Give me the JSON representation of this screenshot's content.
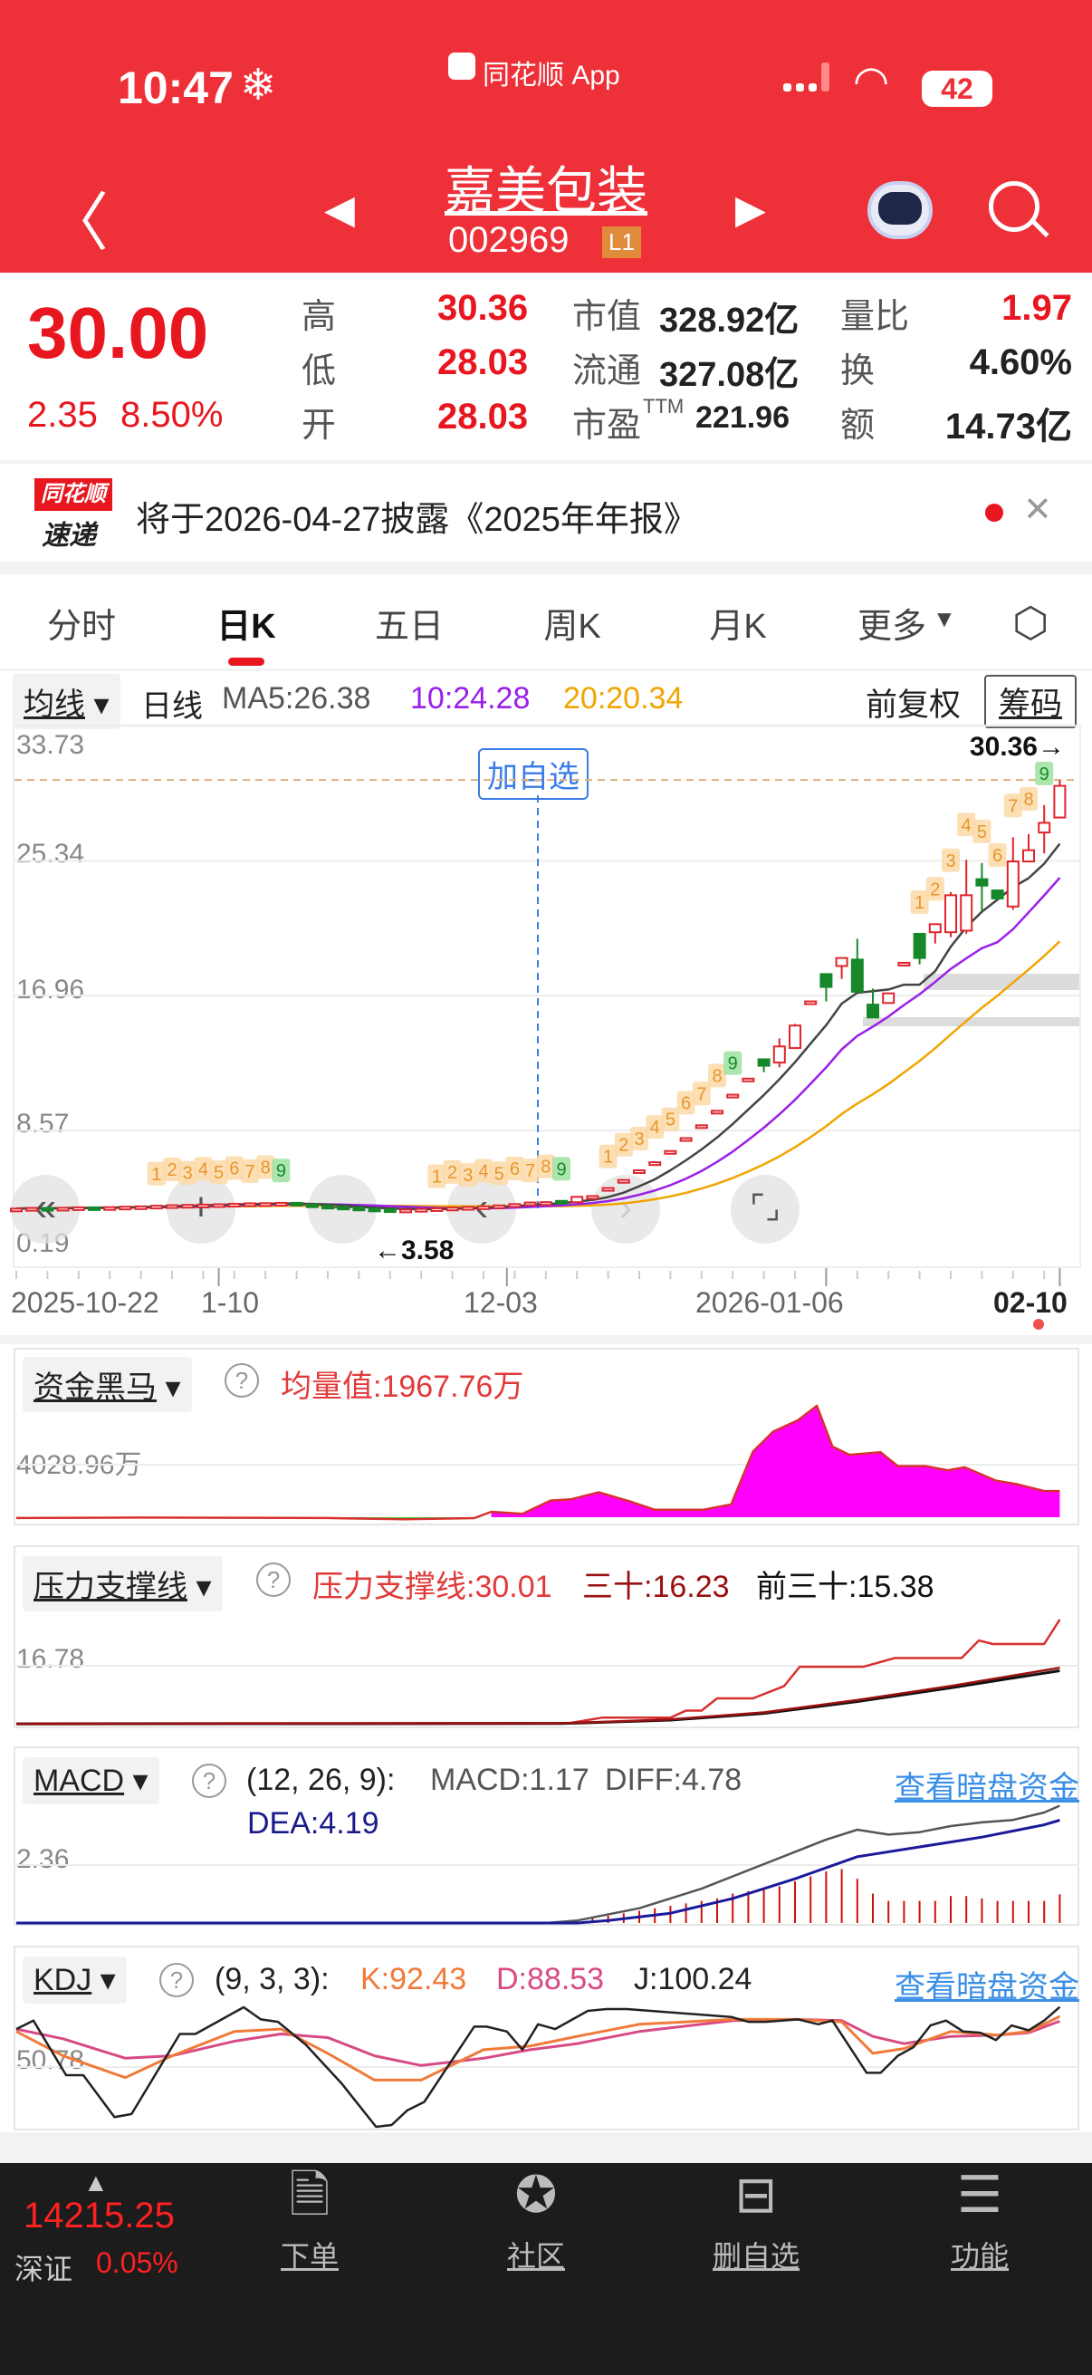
{
  "status_bar": {
    "time": "10:47",
    "app": "同花顺 App",
    "battery": "42"
  },
  "header": {
    "stock_name": "嘉美包装",
    "stock_code": "002969",
    "level_badge": "L1"
  },
  "quote": {
    "price": "30.00",
    "change": "2.35",
    "change_pct": "8.50%",
    "rows": [
      {
        "l1": "高",
        "v1": "30.36",
        "l2": "市值",
        "v2": "328.92亿",
        "l3": "量比",
        "v3": "1.97"
      },
      {
        "l1": "低",
        "v1": "28.03",
        "l2": "流通",
        "v2": "327.08亿",
        "l3": "换",
        "v3": "4.60%"
      },
      {
        "l1": "开",
        "v1": "28.03",
        "l2": "市盈",
        "l2sup": "TTM",
        "v2": "221.96",
        "l3": "额",
        "v3": "14.73亿"
      }
    ]
  },
  "notice": {
    "logo_top": "同花顺",
    "logo_bottom": "速递",
    "text": "将于2026-04-27披露《2025年年报》"
  },
  "tabs": [
    "分时",
    "日K",
    "五日",
    "周K",
    "月K",
    "更多"
  ],
  "active_tab": "日K",
  "ma_bar": {
    "selector": "均线",
    "period": "日线",
    "ma5": "MA5:26.38",
    "ma10": "10:24.28",
    "ma20": "20:20.34",
    "adjust": "前复权",
    "chips": "筹码"
  },
  "kchart": {
    "add_watch": "加自选",
    "high_marker": "30.36→",
    "low_marker": "←3.58",
    "y_labels": [
      "33.73",
      "25.34",
      "16.96",
      "8.57",
      "0.19"
    ],
    "dates": [
      "2025-10-22",
      "1-10",
      "12-03",
      "2026-01-06",
      "02-10"
    ]
  },
  "colors": {
    "up": "#e0242a",
    "down": "#16882a",
    "ma5": "#444444",
    "ma10": "#9b1fe8",
    "ma20": "#f0a500"
  },
  "panels": {
    "zjhm": {
      "selector": "资金黑马",
      "value": "均量值:1967.76万",
      "axis": "4028.96万"
    },
    "ylzc": {
      "selector": "压力支撑线",
      "v1": "压力支撑线:30.01",
      "v2": "三十:16.23",
      "v3": "前三十:15.38",
      "axis": "16.78"
    },
    "macd": {
      "selector": "MACD",
      "params": "(12, 26, 9):",
      "macd": "MACD:1.17",
      "diff": "DIFF:4.78",
      "dea": "DEA:4.19",
      "axis": "2.36",
      "link": "查看暗盘资金"
    },
    "kdj": {
      "selector": "KDJ",
      "params": "(9, 3, 3):",
      "k": "K:92.43",
      "d": "D:88.53",
      "j": "J:100.24",
      "axis": "50.78",
      "link": "查看暗盘资金"
    }
  },
  "bottom": {
    "index_value": "14215.25",
    "index_name": "深证",
    "index_pct": "0.05%",
    "items": [
      "下单",
      "社区",
      "删自选",
      "功能"
    ]
  },
  "chart_data": {
    "type": "candlestick",
    "ylim": [
      0.19,
      33.73
    ],
    "ohlc": [
      [
        3.7,
        3.74,
        3.66,
        3.72
      ],
      [
        3.72,
        3.78,
        3.7,
        3.76
      ],
      [
        3.76,
        3.8,
        3.72,
        3.74
      ],
      [
        3.74,
        3.79,
        3.71,
        3.77
      ],
      [
        3.77,
        3.82,
        3.74,
        3.8
      ],
      [
        3.8,
        3.84,
        3.76,
        3.78
      ],
      [
        3.78,
        3.83,
        3.75,
        3.81
      ],
      [
        3.81,
        3.86,
        3.78,
        3.84
      ],
      [
        3.84,
        3.88,
        3.8,
        3.86
      ],
      [
        3.86,
        3.92,
        3.83,
        3.9
      ],
      [
        3.9,
        3.96,
        3.86,
        3.93
      ],
      [
        3.93,
        3.98,
        3.88,
        3.95
      ],
      [
        3.95,
        4.0,
        3.9,
        3.97
      ],
      [
        3.97,
        4.02,
        3.92,
        3.99
      ],
      [
        3.99,
        4.05,
        3.94,
        4.02
      ],
      [
        4.02,
        4.08,
        3.96,
        4.05
      ],
      [
        4.05,
        4.1,
        3.98,
        4.06
      ],
      [
        4.06,
        4.12,
        4.0,
        4.08
      ],
      [
        4.08,
        4.1,
        3.95,
        3.98
      ],
      [
        3.98,
        4.0,
        3.88,
        3.9
      ],
      [
        3.9,
        3.93,
        3.8,
        3.84
      ],
      [
        3.84,
        3.86,
        3.74,
        3.78
      ],
      [
        3.78,
        3.8,
        3.68,
        3.72
      ],
      [
        3.72,
        3.75,
        3.64,
        3.68
      ],
      [
        3.68,
        3.72,
        3.6,
        3.64
      ],
      [
        3.64,
        3.68,
        3.58,
        3.66
      ],
      [
        3.66,
        3.72,
        3.62,
        3.7
      ],
      [
        3.7,
        3.76,
        3.66,
        3.74
      ],
      [
        3.74,
        3.8,
        3.7,
        3.78
      ],
      [
        3.78,
        3.84,
        3.74,
        3.82
      ],
      [
        3.82,
        3.88,
        3.78,
        3.86
      ],
      [
        3.86,
        3.94,
        3.82,
        3.92
      ],
      [
        3.92,
        4.02,
        3.88,
        4.0
      ],
      [
        4.0,
        4.12,
        3.96,
        4.1
      ],
      [
        4.0,
        4.15,
        3.98,
        4.12
      ],
      [
        4.2,
        4.22,
        4.08,
        4.12
      ],
      [
        4.12,
        4.5,
        4.1,
        4.45
      ],
      [
        4.45,
        4.55,
        4.4,
        4.5
      ],
      [
        4.9,
        5.0,
        4.9,
        5.0
      ],
      [
        5.4,
        5.5,
        5.4,
        5.5
      ],
      [
        6.0,
        6.1,
        6.0,
        6.1
      ],
      [
        6.5,
        6.6,
        6.5,
        6.6
      ],
      [
        7.2,
        7.3,
        7.2,
        7.3
      ],
      [
        8.0,
        8.1,
        8.0,
        8.1
      ],
      [
        8.8,
        8.9,
        8.8,
        8.9
      ],
      [
        9.7,
        9.8,
        9.7,
        9.8
      ],
      [
        10.7,
        10.8,
        10.7,
        10.8
      ],
      [
        11.7,
        11.8,
        11.7,
        11.8
      ],
      [
        13.0,
        13.0,
        12.2,
        12.6
      ],
      [
        12.8,
        14.3,
        12.5,
        13.8
      ],
      [
        13.7,
        15.2,
        13.7,
        15.1
      ],
      [
        16.5,
        16.6,
        16.5,
        16.6
      ],
      [
        18.3,
        18.3,
        16.6,
        17.5
      ],
      [
        18.8,
        19.3,
        18.0,
        19.3
      ],
      [
        19.2,
        20.5,
        17.2,
        17.2
      ],
      [
        16.4,
        17.4,
        15.6,
        15.6
      ],
      [
        16.5,
        17.1,
        16.5,
        17.1
      ],
      [
        18.9,
        19.0,
        18.9,
        19.0
      ],
      [
        20.8,
        20.8,
        18.9,
        19.3
      ],
      [
        20.9,
        21.4,
        20.2,
        21.4
      ],
      [
        20.9,
        23.4,
        20.6,
        23.2
      ],
      [
        21.0,
        25.4,
        20.8,
        23.2
      ],
      [
        24.2,
        25.2,
        22.2,
        23.8
      ],
      [
        23.5,
        23.5,
        22.9,
        23.0
      ],
      [
        22.5,
        26.8,
        22.3,
        25.3
      ],
      [
        25.3,
        27.0,
        25.3,
        26.0
      ],
      [
        27.1,
        28.8,
        25.8,
        27.7
      ],
      [
        28.03,
        30.36,
        28.03,
        30.0
      ]
    ],
    "td_sequences": [
      9,
      27,
      38,
      58
    ],
    "zjhm": [
      [
        0,
        -60
      ],
      [
        7.9,
        -30
      ],
      [
        14.6,
        -40
      ],
      [
        20,
        -60
      ],
      [
        24.9,
        -150
      ],
      [
        29.4,
        -70
      ],
      [
        30.5,
        415
      ],
      [
        32.5,
        255
      ],
      [
        34.3,
        1280
      ],
      [
        35.6,
        1370
      ],
      [
        37.4,
        1910
      ],
      [
        39.4,
        1210
      ],
      [
        41,
        570
      ],
      [
        44.1,
        570
      ],
      [
        45.9,
        990
      ],
      [
        47.3,
        5040
      ],
      [
        48.6,
        6570
      ],
      [
        50.2,
        7440
      ],
      [
        51.4,
        8550
      ],
      [
        52.4,
        5420
      ],
      [
        53.5,
        4790
      ],
      [
        55.5,
        4980
      ],
      [
        56.6,
        3920
      ],
      [
        58.4,
        3920
      ],
      [
        59.8,
        3600
      ],
      [
        60.9,
        3830
      ],
      [
        62.9,
        2810
      ],
      [
        64.2,
        2550
      ],
      [
        66,
        2010
      ],
      [
        67,
        2010
      ]
    ],
    "ylzc": {
      "pressure": [
        [
          0,
          0.3
        ],
        [
          35.6,
          0.5
        ],
        [
          37.6,
          2
        ],
        [
          42,
          2
        ],
        [
          43,
          4
        ],
        [
          44,
          4
        ],
        [
          45,
          7.5
        ],
        [
          47.3,
          7.5
        ],
        [
          49.3,
          11
        ],
        [
          50.3,
          16.5
        ],
        [
          54.4,
          16.5
        ],
        [
          56.4,
          19
        ],
        [
          60.7,
          19
        ],
        [
          61.8,
          24
        ],
        [
          62.7,
          23
        ],
        [
          66,
          23
        ],
        [
          67,
          30.01
        ]
      ],
      "thirty": [
        [
          0,
          0.2
        ],
        [
          35,
          0.4
        ],
        [
          42,
          1.5
        ],
        [
          48,
          3.5
        ],
        [
          54,
          7
        ],
        [
          60,
          11
        ],
        [
          64,
          14
        ],
        [
          67,
          16.23
        ]
      ],
      "prev_thirty": [
        [
          0,
          0.2
        ],
        [
          35,
          0.3
        ],
        [
          42,
          1.3
        ],
        [
          48,
          3.2
        ],
        [
          54,
          6.6
        ],
        [
          60,
          10.5
        ],
        [
          64,
          13.3
        ],
        [
          67,
          15.38
        ]
      ]
    },
    "macd": {
      "diff": [
        [
          0,
          0
        ],
        [
          34,
          0
        ],
        [
          36,
          0.1
        ],
        [
          40,
          0.6
        ],
        [
          44,
          1.4
        ],
        [
          48,
          2.4
        ],
        [
          52,
          3.4
        ],
        [
          54,
          3.8
        ],
        [
          56,
          3.6
        ],
        [
          58,
          3.7
        ],
        [
          60,
          3.95
        ],
        [
          62,
          4.1
        ],
        [
          64,
          4.2
        ],
        [
          66,
          4.5
        ],
        [
          67,
          4.78
        ]
      ],
      "dea": [
        [
          0,
          0
        ],
        [
          36,
          0
        ],
        [
          38,
          0.1
        ],
        [
          42,
          0.4
        ],
        [
          46,
          1.0
        ],
        [
          50,
          1.8
        ],
        [
          54,
          2.7
        ],
        [
          58,
          3.1
        ],
        [
          62,
          3.5
        ],
        [
          66,
          4.0
        ],
        [
          67,
          4.19
        ]
      ],
      "bars_from": 36,
      "bars": [
        0.1,
        0.2,
        0.3,
        0.4,
        0.5,
        0.6,
        0.7,
        0.8,
        0.9,
        1.0,
        1.2,
        1.3,
        1.4,
        1.5,
        1.7,
        1.9,
        2.1,
        2.2,
        1.8,
        1.2,
        0.9,
        0.9,
        0.9,
        0.9,
        1.1,
        1.1,
        1.0,
        0.9,
        0.9,
        0.9,
        0.9,
        1.17
      ]
    },
    "kdj": {
      "k": [
        [
          0,
          80
        ],
        [
          3,
          60
        ],
        [
          7,
          42
        ],
        [
          10,
          60
        ],
        [
          14,
          80
        ],
        [
          17,
          82
        ],
        [
          20,
          62
        ],
        [
          23,
          40
        ],
        [
          26,
          40
        ],
        [
          30,
          65
        ],
        [
          33,
          68
        ],
        [
          36,
          76
        ],
        [
          40,
          86
        ],
        [
          46,
          90
        ],
        [
          50,
          90
        ],
        [
          53,
          88
        ],
        [
          55,
          62
        ],
        [
          57,
          66
        ],
        [
          60,
          80
        ],
        [
          63,
          77
        ],
        [
          65,
          80
        ],
        [
          67,
          92.43
        ]
      ],
      "d": [
        [
          0,
          82
        ],
        [
          3,
          74
        ],
        [
          7,
          58
        ],
        [
          10,
          60
        ],
        [
          14,
          72
        ],
        [
          17,
          78
        ],
        [
          20,
          75
        ],
        [
          23,
          60
        ],
        [
          26,
          52
        ],
        [
          30,
          58
        ],
        [
          33,
          65
        ],
        [
          36,
          70
        ],
        [
          40,
          80
        ],
        [
          46,
          89
        ],
        [
          50,
          90
        ],
        [
          53,
          89
        ],
        [
          55,
          76
        ],
        [
          57,
          70
        ],
        [
          60,
          76
        ],
        [
          63,
          77
        ],
        [
          65,
          79
        ],
        [
          67,
          88.53
        ]
      ],
      "j": [
        [
          0,
          82
        ],
        [
          1.1,
          89
        ],
        [
          3.2,
          44
        ],
        [
          4.3,
          44
        ],
        [
          6.3,
          9.5
        ],
        [
          7.4,
          12
        ],
        [
          10.5,
          78
        ],
        [
          11.5,
          78
        ],
        [
          14.6,
          100
        ],
        [
          15.7,
          90
        ],
        [
          16.8,
          88
        ],
        [
          18.6,
          69
        ],
        [
          20.9,
          37
        ],
        [
          23.1,
          1
        ],
        [
          24.1,
          3
        ],
        [
          25.1,
          15
        ],
        [
          26.2,
          22
        ],
        [
          29.4,
          84
        ],
        [
          30.2,
          84
        ],
        [
          31.5,
          80
        ],
        [
          32.5,
          65
        ],
        [
          33.5,
          86
        ],
        [
          34.6,
          82
        ],
        [
          36.7,
          97
        ],
        [
          37.9,
          98.5
        ],
        [
          39.2,
          98.5
        ],
        [
          45.9,
          92
        ],
        [
          47,
          88
        ],
        [
          48.1,
          88
        ],
        [
          50.2,
          90
        ],
        [
          51.5,
          86
        ],
        [
          52.4,
          89
        ],
        [
          54.6,
          46
        ],
        [
          55.5,
          46
        ],
        [
          56.6,
          60
        ],
        [
          57.6,
          67
        ],
        [
          58.7,
          85
        ],
        [
          59.7,
          89
        ],
        [
          60.8,
          80
        ],
        [
          61.9,
          79
        ],
        [
          62.9,
          73
        ],
        [
          63.9,
          85
        ],
        [
          65,
          81
        ],
        [
          66,
          89
        ],
        [
          67,
          100.24
        ]
      ]
    }
  }
}
